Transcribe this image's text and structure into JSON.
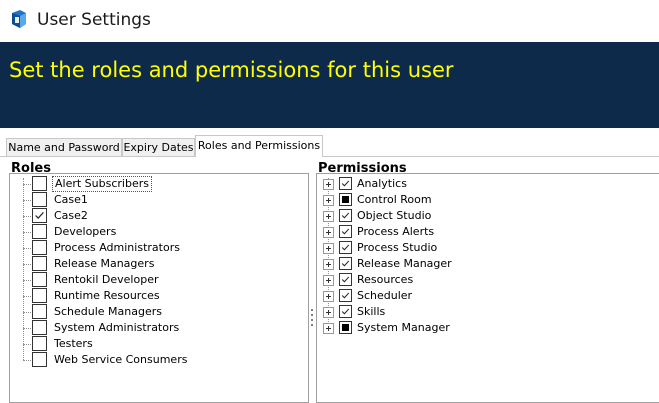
{
  "window": {
    "title": "User Settings",
    "icon": "blue-prism-app-icon"
  },
  "banner": {
    "text": "Set the roles and permissions for this user",
    "background": "#0d2a4a",
    "text_color": "#ffff00"
  },
  "tabs": [
    {
      "label": "Name and Password",
      "active": false
    },
    {
      "label": "Expiry Dates",
      "active": false
    },
    {
      "label": "Roles and Permissions",
      "active": true
    }
  ],
  "roles": {
    "heading": "Roles",
    "items": [
      {
        "label": "Alert Subscribers",
        "state": "unchecked",
        "selected": true
      },
      {
        "label": "Case1",
        "state": "unchecked",
        "selected": false
      },
      {
        "label": "Case2",
        "state": "checked",
        "selected": false
      },
      {
        "label": "Developers",
        "state": "unchecked",
        "selected": false
      },
      {
        "label": "Process Administrators",
        "state": "unchecked",
        "selected": false
      },
      {
        "label": "Release Managers",
        "state": "unchecked",
        "selected": false
      },
      {
        "label": "Rentokil Developer",
        "state": "unchecked",
        "selected": false
      },
      {
        "label": "Runtime Resources",
        "state": "unchecked",
        "selected": false
      },
      {
        "label": "Schedule Managers",
        "state": "unchecked",
        "selected": false
      },
      {
        "label": "System Administrators",
        "state": "unchecked",
        "selected": false
      },
      {
        "label": "Testers",
        "state": "unchecked",
        "selected": false
      },
      {
        "label": "Web Service Consumers",
        "state": "unchecked",
        "selected": false
      }
    ]
  },
  "permissions": {
    "heading": "Permissions",
    "items": [
      {
        "label": "Analytics",
        "state": "checked"
      },
      {
        "label": "Control Room",
        "state": "partial"
      },
      {
        "label": "Object Studio",
        "state": "checked"
      },
      {
        "label": "Process Alerts",
        "state": "checked"
      },
      {
        "label": "Process Studio",
        "state": "checked"
      },
      {
        "label": "Release Manager",
        "state": "checked"
      },
      {
        "label": "Resources",
        "state": "checked"
      },
      {
        "label": "Scheduler",
        "state": "checked"
      },
      {
        "label": "Skills",
        "state": "checked"
      },
      {
        "label": "System Manager",
        "state": "partial"
      }
    ]
  }
}
